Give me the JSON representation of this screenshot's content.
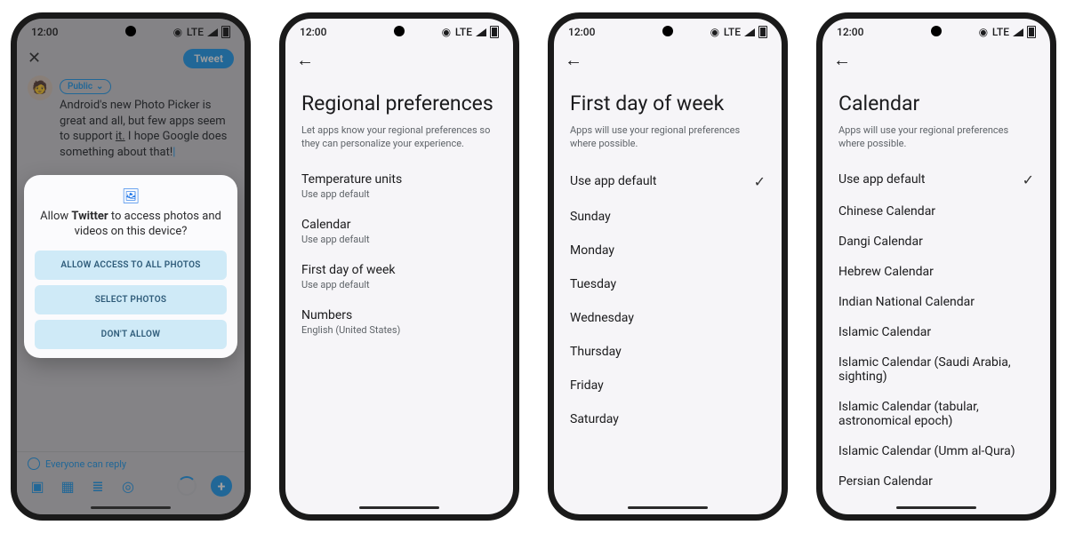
{
  "status": {
    "time": "12:00",
    "net": "LTE"
  },
  "phone1": {
    "tweet_button": "Tweet",
    "audience": "Public",
    "text_a": "Android's new Photo Picker is great and all, but few apps seem to support ",
    "text_b": "it.",
    "text_c": " I hope Google does something about that!",
    "reply": "Everyone can reply",
    "dialog": {
      "title_a": "Allow ",
      "title_bold": "Twitter",
      "title_b": " to access photos and videos on this device?",
      "opt_all": "Allow access to all photos",
      "opt_select": "Select photos",
      "opt_deny": "Don't allow"
    }
  },
  "phone2": {
    "title": "Regional preferences",
    "subtitle": "Let apps know your regional preferences so they can personalize your experience.",
    "prefs": {
      "temp_label": "Temperature units",
      "temp_val": "Use app default",
      "cal_label": "Calendar",
      "cal_val": "Use app default",
      "dow_label": "First day of week",
      "dow_val": "Use app default",
      "num_label": "Numbers",
      "num_val": "English (United States)"
    }
  },
  "phone3": {
    "title": "First day of week",
    "subtitle": "Apps will use your regional preferences where possible.",
    "options": {
      "o0": "Use app default",
      "o1": "Sunday",
      "o2": "Monday",
      "o3": "Tuesday",
      "o4": "Wednesday",
      "o5": "Thursday",
      "o6": "Friday",
      "o7": "Saturday"
    }
  },
  "phone4": {
    "title": "Calendar",
    "subtitle": "Apps will use your regional preferences where possible.",
    "options": {
      "o0": "Use app default",
      "o1": "Chinese Calendar",
      "o2": "Dangi Calendar",
      "o3": "Hebrew Calendar",
      "o4": "Indian National Calendar",
      "o5": "Islamic Calendar",
      "o6": "Islamic Calendar (Saudi Arabia, sighting)",
      "o7": "Islamic Calendar (tabular, astronomical epoch)",
      "o8": "Islamic Calendar (Umm al-Qura)",
      "o9": "Persian Calendar"
    }
  }
}
